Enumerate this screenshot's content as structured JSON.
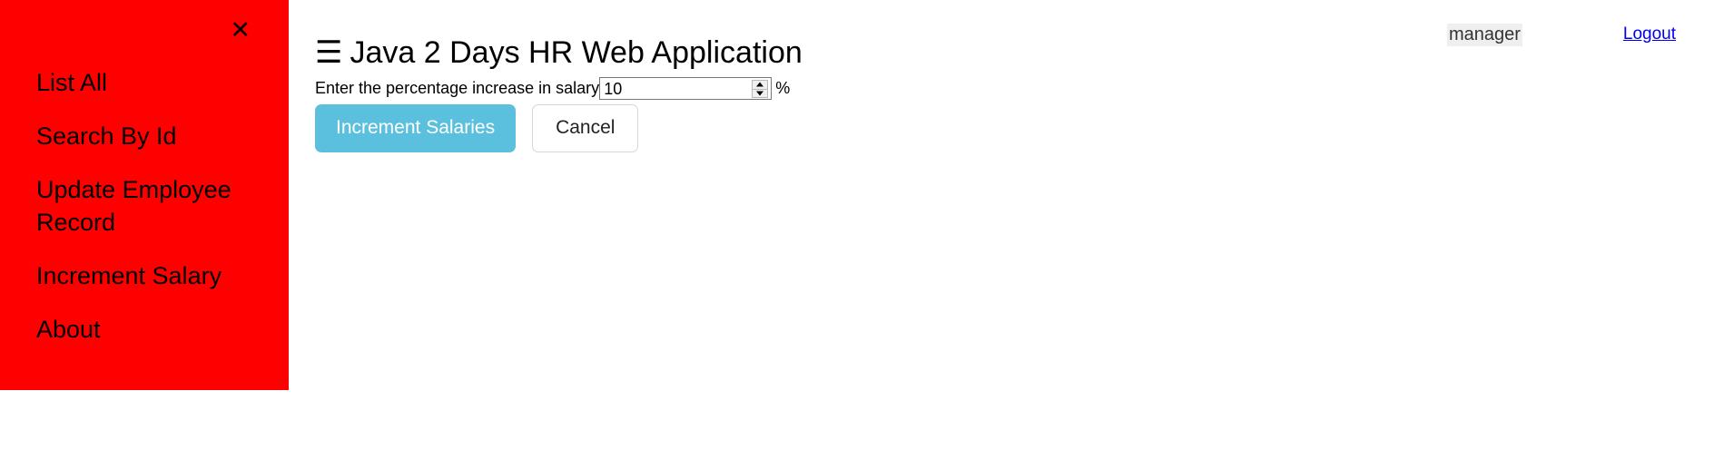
{
  "sidebar": {
    "close_icon": "close-icon",
    "close_glyph": "✕",
    "background_color": "#ff0000",
    "items": [
      {
        "label": "List All"
      },
      {
        "label": "Search By Id"
      },
      {
        "label": "Update Employee Record"
      },
      {
        "label": "Increment Salary"
      },
      {
        "label": "About"
      }
    ]
  },
  "header": {
    "menu_icon": "hamburger-icon",
    "menu_glyph": "☰",
    "title": "Java 2 Days HR Web Application",
    "username": "manager",
    "logout_label": "Logout",
    "logout_color": "#0000ee"
  },
  "form": {
    "label": "Enter the percentage increase in salary",
    "percent_value": "10",
    "percent_placeholder": "",
    "percent_suffix": "%",
    "spinner_up_icon": "chevron-up-icon",
    "spinner_down_icon": "chevron-down-icon"
  },
  "buttons": {
    "submit_label": "Increment Salaries",
    "submit_color": "#5bc0de",
    "cancel_label": "Cancel",
    "cancel_color": "#ffffff"
  }
}
